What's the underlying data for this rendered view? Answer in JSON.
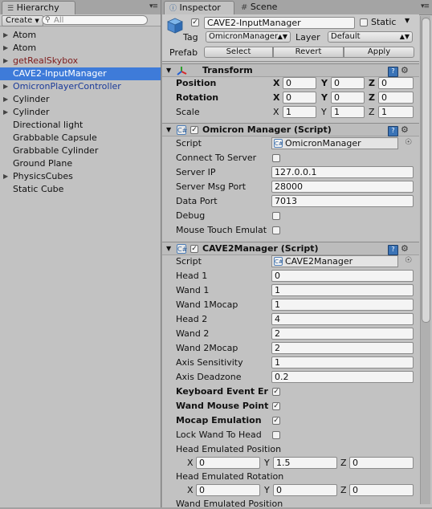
{
  "hierarchy": {
    "tab_label": "Hierarchy",
    "create_label": "Create",
    "search_placeholder": "All",
    "items": [
      {
        "label": "Atom",
        "foldable": true
      },
      {
        "label": "Atom",
        "foldable": true
      },
      {
        "label": "getRealSkybox",
        "foldable": true
      },
      {
        "label": "CAVE2-InputManager",
        "foldable": false
      },
      {
        "label": "OmicronPlayerController",
        "foldable": true
      },
      {
        "label": "Cylinder",
        "foldable": true
      },
      {
        "label": "Cylinder",
        "foldable": true
      },
      {
        "label": "Directional light",
        "foldable": false
      },
      {
        "label": "Grabbable Capsule",
        "foldable": false
      },
      {
        "label": "Grabbable Cylinder",
        "foldable": false
      },
      {
        "label": "Ground Plane",
        "foldable": false
      },
      {
        "label": "PhysicsCubes",
        "foldable": true
      },
      {
        "label": "Static Cube",
        "foldable": false
      }
    ]
  },
  "inspector": {
    "tab_label": "Inspector",
    "scene_tab_label": "Scene",
    "object_name": "CAVE2-InputManager",
    "static_label": "Static",
    "tag_label": "Tag",
    "tag_value": "OmicronManager",
    "layer_label": "Layer",
    "layer_value": "Default",
    "prefab_label": "Prefab",
    "select_label": "Select",
    "revert_label": "Revert",
    "apply_label": "Apply",
    "transform": {
      "title": "Transform",
      "position_label": "Position",
      "rotation_label": "Rotation",
      "scale_label": "Scale",
      "x_label": "X",
      "y_label": "Y",
      "z_label": "Z",
      "position": [
        "0",
        "0",
        "0"
      ],
      "rotation": [
        "0",
        "0",
        "0"
      ],
      "scale": [
        "1",
        "1",
        "1"
      ]
    },
    "omicron": {
      "title": "Omicron Manager (Script)",
      "script_label": "Script",
      "script_value": "OmicronManager",
      "connect_label": "Connect To Server",
      "ip_label": "Server IP",
      "ip_value": "127.0.0.1",
      "port_label": "Server Msg Port",
      "port_value": "28000",
      "data_port_label": "Data Port",
      "data_port_value": "7013",
      "debug_label": "Debug",
      "touch_label": "Mouse Touch Emulat"
    },
    "cave2": {
      "title": "CAVE2Manager (Script)",
      "script_label": "Script",
      "script_value": "CAVE2Manager",
      "fields": [
        {
          "label": "Head 1",
          "value": "0"
        },
        {
          "label": "Wand 1",
          "value": "1"
        },
        {
          "label": "Wand 1Mocap",
          "value": "1"
        },
        {
          "label": "Head 2",
          "value": "4"
        },
        {
          "label": "Wand 2",
          "value": "2"
        },
        {
          "label": "Wand 2Mocap",
          "value": "2"
        },
        {
          "label": "Axis Sensitivity",
          "value": "1"
        },
        {
          "label": "Axis Deadzone",
          "value": "0.2"
        }
      ],
      "keyboard_label": "Keyboard Event Er",
      "wandmouse_label": "Wand Mouse Point",
      "mocap_label": "Mocap Emulation",
      "lockwand_label": "Lock Wand To Head",
      "head_pos_label": "Head Emulated Position",
      "head_pos": [
        "0",
        "1.5",
        "0"
      ],
      "head_rot_label": "Head Emulated Rotation",
      "head_rot": [
        "0",
        "0",
        "0"
      ],
      "wand_pos_label": "Wand Emulated Position"
    }
  }
}
